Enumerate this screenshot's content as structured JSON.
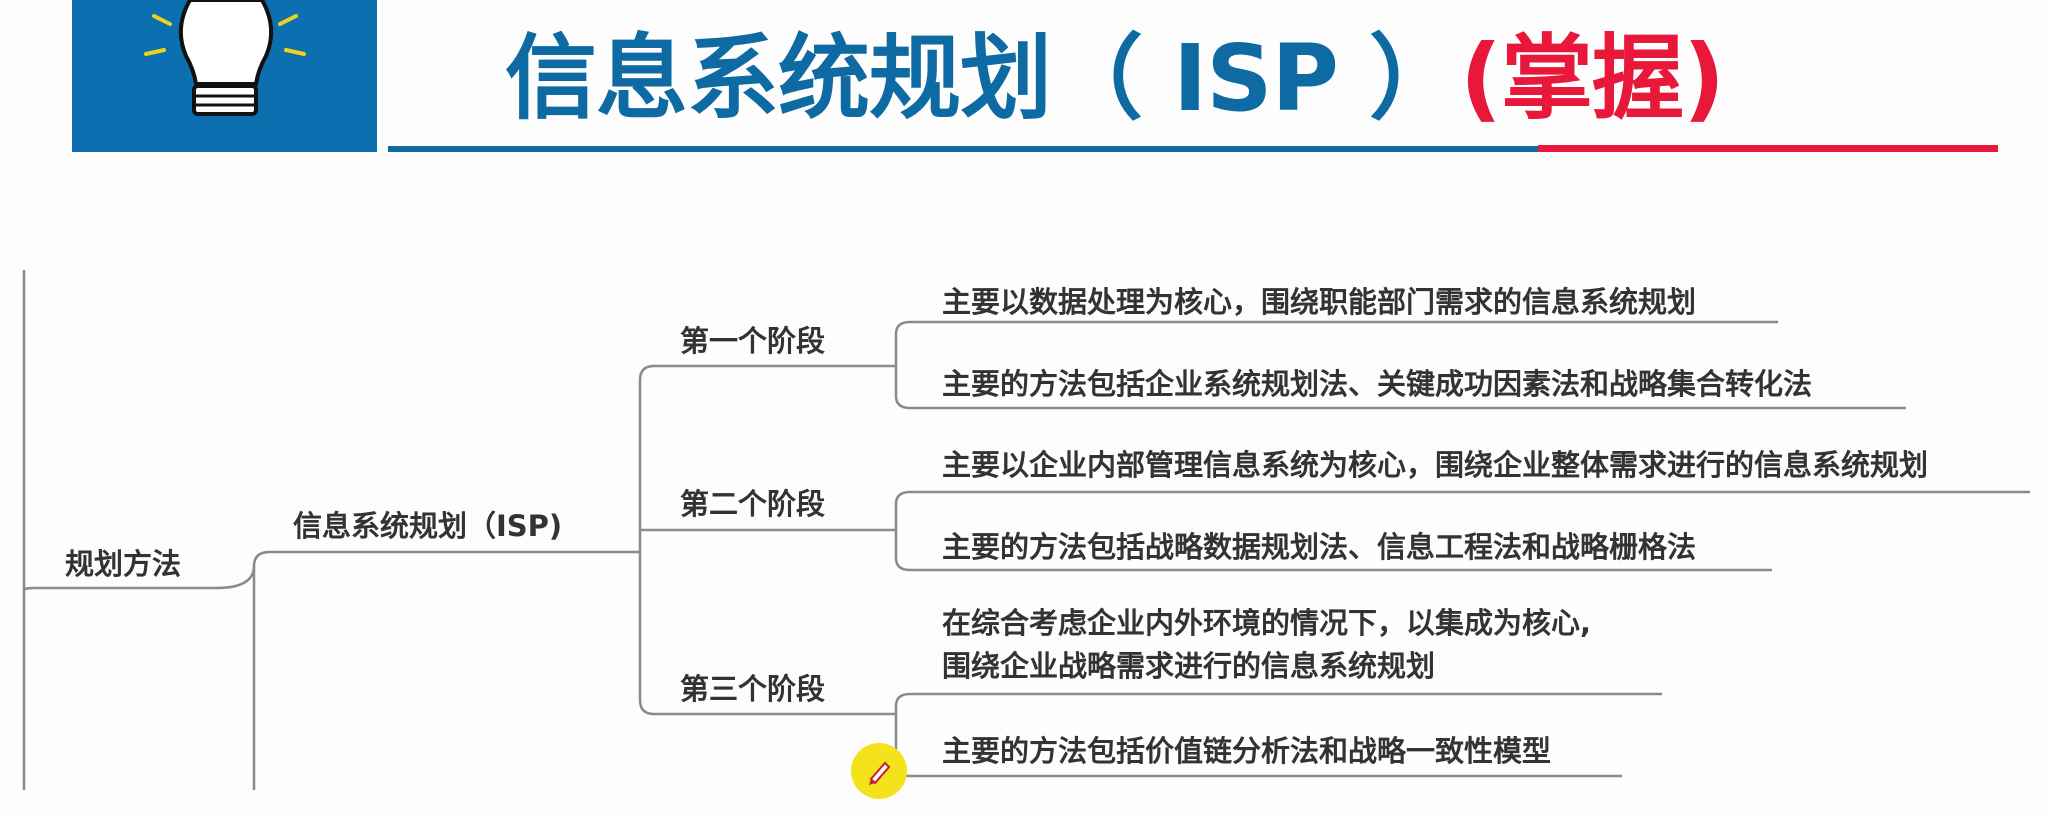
{
  "header": {
    "title_main": "信息系统规划（ ISP ）",
    "title_accent": "(掌握)",
    "logo_icon": "lightbulb-icon",
    "colors": {
      "blue": "#0e6aa3",
      "red": "#e8183a",
      "logo_bg": "#0b6fb0"
    }
  },
  "mindmap": {
    "root": "规划方法",
    "topic": "信息系统规划（ISP)",
    "stages": [
      {
        "label": "第一个阶段",
        "items": [
          "主要以数据处理为核心，围绕职能部门需求的信息系统规划",
          "主要的方法包括企业系统规划法、关键成功因素法和战略集合转化法"
        ]
      },
      {
        "label": "第二个阶段",
        "items": [
          "主要以企业内部管理信息系统为核心，围绕企业整体需求进行的信息系统规划",
          "主要的方法包括战略数据规划法、信息工程法和战略栅格法"
        ]
      },
      {
        "label": "第三个阶段",
        "items": [
          "在综合考虑企业内外环境的情况下，以集成为核心,",
          "围绕企业战略需求进行的信息系统规划",
          "主要的方法包括价值链分析法和战略一致性模型"
        ]
      }
    ]
  },
  "cursor_icon": "pen-cursor-icon"
}
